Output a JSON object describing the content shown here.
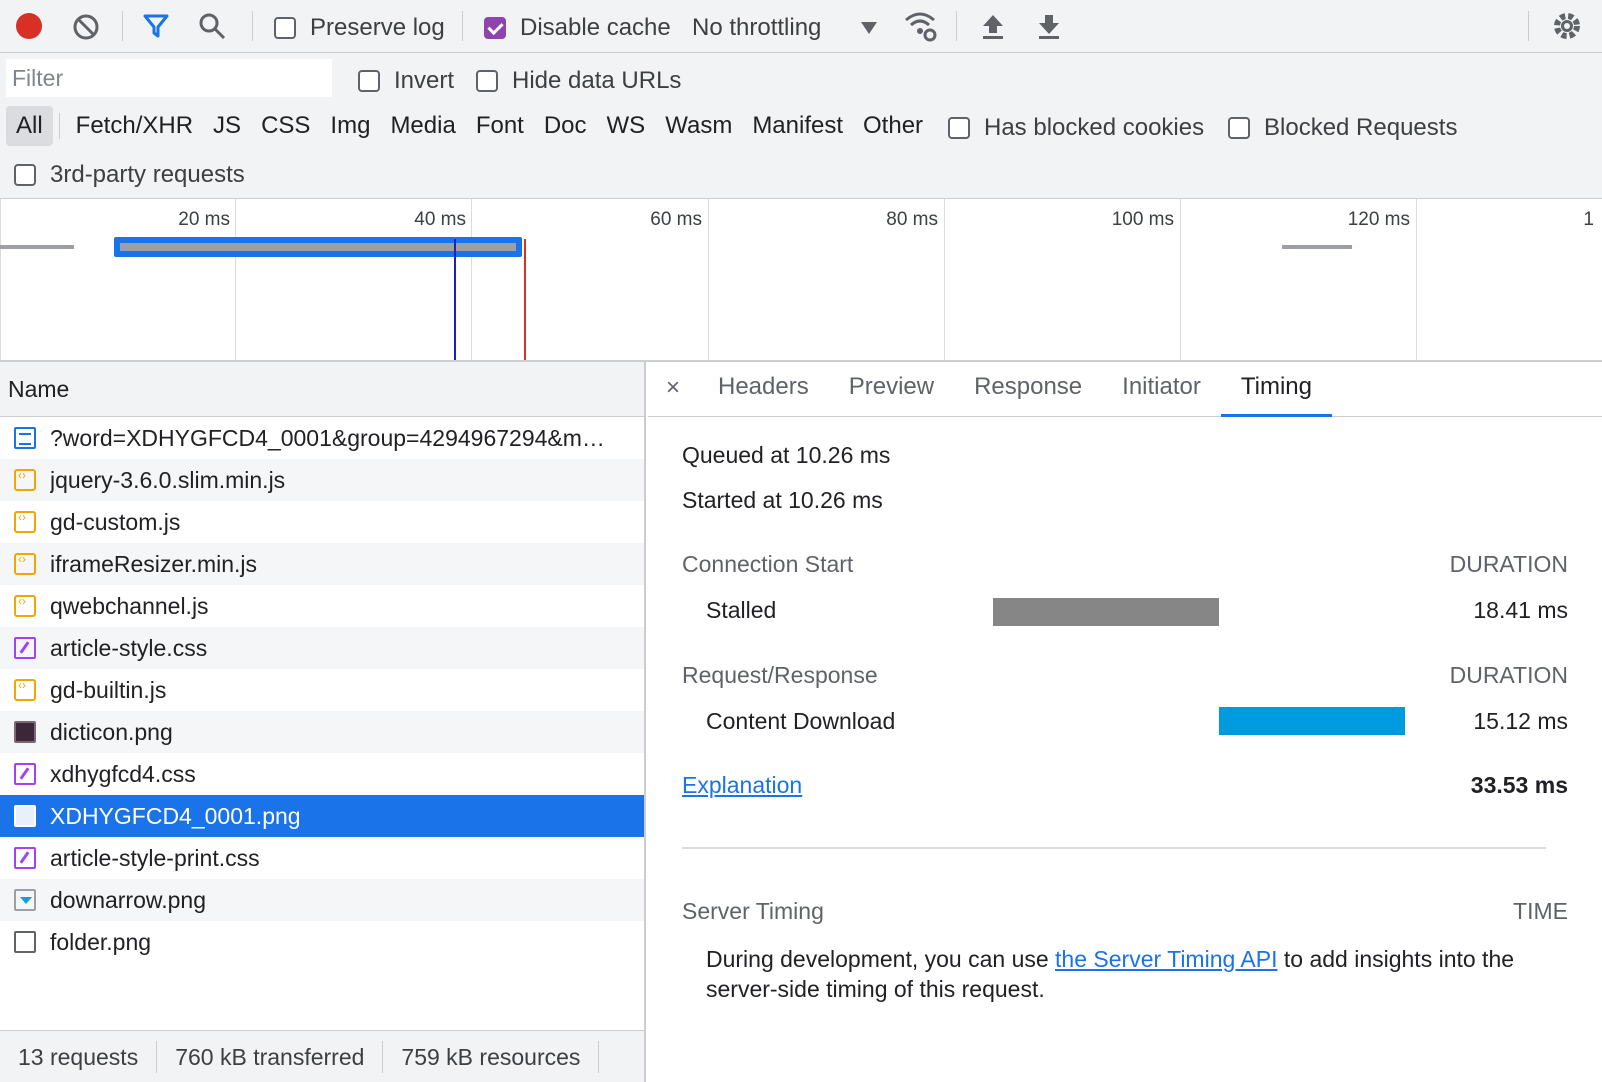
{
  "toolbar": {
    "preserve_log": "Preserve log",
    "disable_cache": "Disable cache",
    "throttling": "No throttling"
  },
  "filter": {
    "placeholder": "Filter",
    "invert": "Invert",
    "hide_data_urls": "Hide data URLs",
    "types": [
      "All",
      "Fetch/XHR",
      "JS",
      "CSS",
      "Img",
      "Media",
      "Font",
      "Doc",
      "WS",
      "Wasm",
      "Manifest",
      "Other"
    ],
    "has_blocked_cookies": "Has blocked cookies",
    "blocked_requests": "Blocked Requests",
    "third_party": "3rd-party requests"
  },
  "overview": {
    "ticks": [
      "20 ms",
      "40 ms",
      "60 ms",
      "80 ms",
      "100 ms",
      "120 ms",
      "1"
    ]
  },
  "list": {
    "header": "Name",
    "rows": [
      {
        "name": "?word=XDHYGFCD4_0001&group=4294967294&m…",
        "icon": "document-icon"
      },
      {
        "name": "jquery-3.6.0.slim.min.js",
        "icon": "script-icon"
      },
      {
        "name": "gd-custom.js",
        "icon": "script-icon"
      },
      {
        "name": "iframeResizer.min.js",
        "icon": "script-icon"
      },
      {
        "name": "qwebchannel.js",
        "icon": "script-icon"
      },
      {
        "name": "article-style.css",
        "icon": "stylesheet-icon"
      },
      {
        "name": "gd-builtin.js",
        "icon": "script-icon"
      },
      {
        "name": "dicticon.png",
        "icon": "image-icon"
      },
      {
        "name": "xdhygfcd4.css",
        "icon": "stylesheet-icon"
      },
      {
        "name": "XDHYGFCD4_0001.png",
        "icon": "image-icon"
      },
      {
        "name": "article-style-print.css",
        "icon": "stylesheet-icon"
      },
      {
        "name": "downarrow.png",
        "icon": "image-icon"
      },
      {
        "name": "folder.png",
        "icon": "image-icon"
      }
    ],
    "status": {
      "requests": "13 requests",
      "transferred": "760 kB transferred",
      "resources": "759 kB resources"
    }
  },
  "detail": {
    "close": "×",
    "tabs": [
      "Headers",
      "Preview",
      "Response",
      "Initiator",
      "Timing"
    ],
    "queued": "Queued at 10.26 ms",
    "started": "Started at 10.26 ms",
    "connection_start": "Connection Start",
    "duration": "DURATION",
    "stalled_label": "Stalled",
    "stalled_value": "18.41 ms",
    "request_response": "Request/Response",
    "content_download_label": "Content Download",
    "content_download_value": "15.12 ms",
    "explanation": "Explanation",
    "total": "33.53 ms",
    "server_timing": "Server Timing",
    "time": "TIME",
    "server_text_before": "During development, you can use ",
    "server_link": "the Server Timing API",
    "server_text_after": " to add insights into the",
    "server_text_line2": "server-side timing of this request."
  },
  "colors": {
    "stalled": "#868686",
    "content_download": "#009ade",
    "selection": "#1a73e8",
    "record": "#d93025"
  }
}
